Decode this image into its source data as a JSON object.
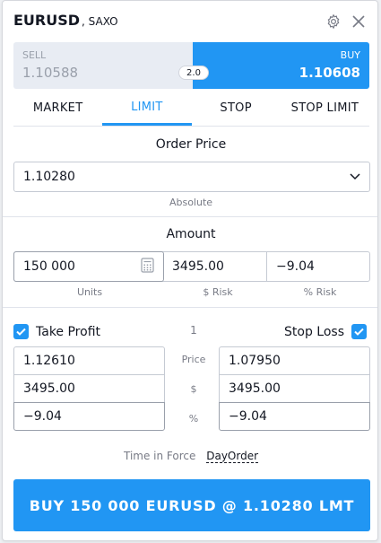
{
  "header": {
    "symbol": "EURUSD",
    "broker": ", SAXO",
    "settings_icon": "gear-icon",
    "close_icon": "close-icon"
  },
  "quote": {
    "sell_label": "SELL",
    "sell_price": "1.10588",
    "buy_label": "BUY",
    "buy_price": "1.10608",
    "spread": "2.0"
  },
  "tabs": [
    "MARKET",
    "LIMIT",
    "STOP",
    "STOP LIMIT"
  ],
  "active_tab": "LIMIT",
  "order_price": {
    "title": "Order Price",
    "value": "1.10280",
    "mode": "Absolute"
  },
  "amount": {
    "title": "Amount",
    "units_value": "150 000",
    "units_label": "Units",
    "risk_value": "3495.00",
    "risk_label": "$ Risk",
    "risk_pct_value": "−9.04",
    "risk_pct_label": "% Risk"
  },
  "brackets": {
    "take_profit_label": "Take Profit",
    "stop_loss_label": "Stop Loss",
    "ratio": "1",
    "row_labels": [
      "Price",
      "$",
      "%"
    ],
    "take_profit": [
      "1.12610",
      "3495.00",
      "−9.04"
    ],
    "stop_loss": [
      "1.07950",
      "3495.00",
      "−9.04"
    ]
  },
  "time_in_force": {
    "label": "Time in Force",
    "value": "DayOrder"
  },
  "submit": {
    "label": "BUY 150 000 EURUSD @ 1.10280 LMT"
  },
  "colors": {
    "accent": "#2196f3",
    "text": "#131722",
    "muted": "#787b86",
    "sell_bg": "#e8ecf3"
  }
}
